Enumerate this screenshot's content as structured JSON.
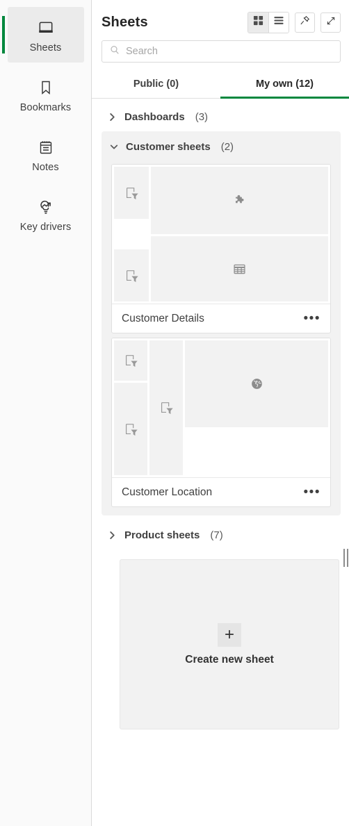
{
  "rail": {
    "items": [
      {
        "label": "Sheets",
        "icon": "sheets-icon",
        "active": true
      },
      {
        "label": "Bookmarks",
        "icon": "bookmark-icon",
        "active": false
      },
      {
        "label": "Notes",
        "icon": "notes-icon",
        "active": false
      },
      {
        "label": "Key drivers",
        "icon": "key-drivers-icon",
        "active": false
      }
    ]
  },
  "header": {
    "title": "Sheets",
    "tools": [
      {
        "name": "grid-view-icon",
        "active": true
      },
      {
        "name": "list-view-icon",
        "active": false
      },
      {
        "name": "pin-icon",
        "active": false
      },
      {
        "name": "expand-icon",
        "active": false
      }
    ]
  },
  "search": {
    "placeholder": "Search",
    "value": "",
    "icon": "search-icon"
  },
  "tabs": [
    {
      "label": "Public (0)",
      "active": false
    },
    {
      "label": "My own (12)",
      "active": true
    }
  ],
  "groups": [
    {
      "title": "Dashboards",
      "count": "(3)",
      "expanded": false
    },
    {
      "title": "Customer sheets",
      "count": "(2)",
      "expanded": true
    },
    {
      "title": "Product sheets",
      "count": "(7)",
      "expanded": false
    }
  ],
  "sheets": [
    {
      "name": "Customer Details",
      "menu": "•••",
      "objects": [
        "filter-pane",
        "filter-pane",
        "extension-object",
        "table-object"
      ]
    },
    {
      "name": "Customer Location",
      "menu": "•••",
      "objects": [
        "filter-pane",
        "filter-pane",
        "filter-pane",
        "map-object"
      ]
    }
  ],
  "create": {
    "label": "Create new sheet",
    "icon": "plus-icon"
  },
  "colors": {
    "accent": "#00873d",
    "panel_bg": "#f2f2f2",
    "rail_bg": "#fafafa",
    "border": "#d9d9d9",
    "text": "#404040"
  }
}
